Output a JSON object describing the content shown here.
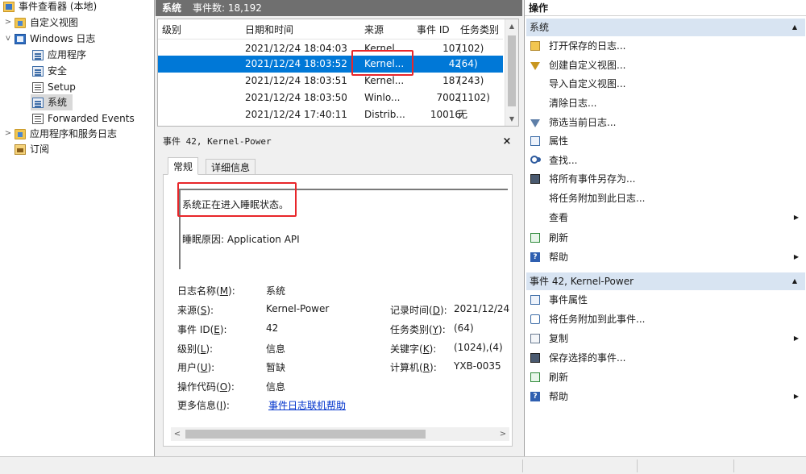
{
  "tree": {
    "root": "事件查看器 (本地)",
    "custom_views": "自定义视图",
    "windows_logs": "Windows 日志",
    "logs": [
      "应用程序",
      "安全",
      "Setup",
      "系统",
      "Forwarded Events"
    ],
    "app_service_logs": "应用程序和服务日志",
    "subscriptions": "订阅"
  },
  "center": {
    "log_name": "系统",
    "count_label": "事件数: 18,192"
  },
  "event_list": {
    "columns": [
      "级别",
      "日期和时间",
      "来源",
      "事件 ID",
      "任务类别"
    ],
    "rows": [
      {
        "level": "信息",
        "datetime": "2021/12/24 18:04:03",
        "source": "Kernel...",
        "id": "107",
        "task": "(102)"
      },
      {
        "level": "信息",
        "datetime": "2021/12/24 18:03:52",
        "source": "Kernel...",
        "id": "42",
        "task": "(64)"
      },
      {
        "level": "信息",
        "datetime": "2021/12/24 18:03:51",
        "source": "Kernel...",
        "id": "187",
        "task": "(243)"
      },
      {
        "level": "信息",
        "datetime": "2021/12/24 18:03:50",
        "source": "Winlo...",
        "id": "7002",
        "task": "(1102)"
      },
      {
        "level": "警告",
        "datetime": "2021/12/24 17:40:11",
        "source": "Distrib...",
        "id": "10016",
        "task": "无"
      }
    ]
  },
  "detail": {
    "title": "事件 42, Kernel-Power",
    "close": "×",
    "tab_general": "常规",
    "tab_details": "详细信息",
    "description_1": "系统正在进入睡眠状态。",
    "description_2": "睡眠原因: Application API",
    "fields_left": [
      {
        "label": "日志名称(",
        "key": "M",
        "value": "系统"
      },
      {
        "label": "来源(",
        "key": "S",
        "value": "Kernel-Power"
      },
      {
        "label": "事件 ID(",
        "key": "E",
        "value": "42"
      },
      {
        "label": "级别(",
        "key": "L",
        "value": "信息"
      },
      {
        "label": "用户(",
        "key": "U",
        "value": "暂缺"
      },
      {
        "label": "操作代码(",
        "key": "O",
        "value": "信息"
      },
      {
        "label": "更多信息(",
        "key": "I",
        "value": "事件日志联机帮助"
      }
    ],
    "fields_right": [
      {
        "label": "记录时间(",
        "key": "D",
        "value": "2021/12/24"
      },
      {
        "label": "任务类别(",
        "key": "Y",
        "value": "(64)"
      },
      {
        "label": "关键字(",
        "key": "K",
        "value": "(1024),(4)"
      },
      {
        "label": "计算机(",
        "key": "R",
        "value": "YXB-0035"
      }
    ],
    "label_suffix": "):"
  },
  "actions": {
    "title": "操作",
    "section1": "系统",
    "items1": [
      {
        "icon": "open-icon",
        "label": "打开保存的日志..."
      },
      {
        "icon": "filter-icon",
        "label": "创建自定义视图..."
      },
      {
        "icon": "",
        "label": "导入自定义视图..."
      },
      {
        "icon": "",
        "label": "清除日志..."
      },
      {
        "icon": "filter-icon",
        "label": "筛选当前日志..."
      },
      {
        "icon": "properties-icon",
        "label": "属性"
      },
      {
        "icon": "find-icon",
        "label": "查找..."
      },
      {
        "icon": "save-icon",
        "label": "将所有事件另存为..."
      },
      {
        "icon": "",
        "label": "将任务附加到此日志..."
      },
      {
        "icon": "",
        "label": "查看"
      },
      {
        "icon": "refresh-icon",
        "label": "刷新"
      },
      {
        "icon": "help-icon",
        "label": "帮助"
      }
    ],
    "section2": "事件 42, Kernel-Power",
    "items2": [
      {
        "icon": "properties-icon",
        "label": "事件属性"
      },
      {
        "icon": "attach-icon",
        "label": "将任务附加到此事件..."
      },
      {
        "icon": "copy-icon",
        "label": "复制"
      },
      {
        "icon": "save-icon",
        "label": "保存选择的事件..."
      },
      {
        "icon": "refresh-icon",
        "label": "刷新"
      },
      {
        "icon": "help-icon",
        "label": "帮助"
      }
    ]
  },
  "colors": {
    "selection": "#0078d7",
    "section_header": "#d8e4f2",
    "highlight_box": "#e8262a",
    "center_header": "#6f6f6f",
    "link": "#0033cc"
  }
}
